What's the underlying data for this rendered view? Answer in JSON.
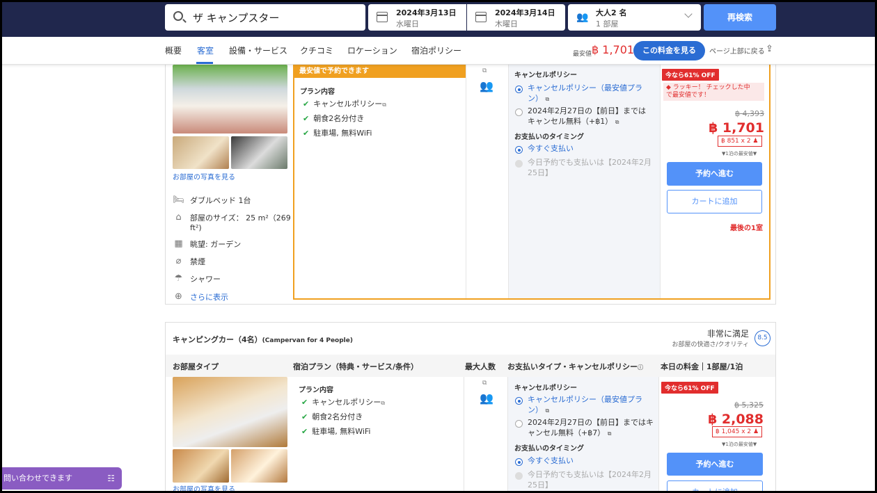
{
  "search": {
    "query": "ザ キャンプスター",
    "checkin_date": "2024年3月13日",
    "checkin_day": "水曜日",
    "checkout_date": "2024年3月14日",
    "checkout_day": "木曜日",
    "guests": "大人2 名",
    "rooms": "1 部屋",
    "button": "再検索"
  },
  "tabs": [
    "概要",
    "客室",
    "設備・サービス",
    "クチコミ",
    "ロケーション",
    "宿泊ポリシー"
  ],
  "tabbar": {
    "cheapest_label": "最安値",
    "cheapest_price": "฿ 1,701",
    "see_price": "この料金を見る",
    "back_to_top": "ページ上部に戻る"
  },
  "room1": {
    "see_photos": "お部屋の写真を見る",
    "amenities": [
      {
        "icon": "bed-icon",
        "text": "ダブルベッド 1台"
      },
      {
        "icon": "room-size-icon",
        "text": "部屋のサイズ： 25 m²（269"
      },
      {
        "icon": "room-size-icon",
        "text": "ft²)"
      },
      {
        "icon": "view-icon",
        "text": "眺望: ガーデン"
      },
      {
        "icon": "no-smoking-icon",
        "text": "禁煙"
      },
      {
        "icon": "shower-icon",
        "text": "シャワー"
      }
    ],
    "show_more": "さらに表示",
    "best_label": "最安値で予約できます",
    "plan_title": "プラン内容",
    "plan_items": [
      "キャンセルポリシー",
      "朝食2名分付き",
      "駐車場, 無料WiFi"
    ],
    "cancel_title": "キャンセルポリシー",
    "cancel_opt1": "キャンセルポリシー（最安値プラ",
    "cancel_opt1b": "ン）",
    "cancel_opt2": "2024年2月27日の【前日】までは",
    "cancel_opt2b": "キャンセル無料（+฿1）",
    "pay_title": "お支払いのタイミング",
    "pay_opt1": "今すぐ支払い",
    "pay_opt2": "今日予約でも支払いは【2024年2月",
    "pay_opt2b": "25日】",
    "off": "今なら61% OFF",
    "lucky": "ラッキー！ チェックした中",
    "lucky2": "で最安値です！",
    "orig": "฿ 4,393",
    "price": "฿ 1,701",
    "pernight": "฿ 851 x 2",
    "lowest": "▼1泊の最安値▼",
    "book": "予約へ進む",
    "cart": "カートに追加",
    "last": "最後の1室"
  },
  "room2": {
    "name": "キャンピングカー（4名）",
    "name_en": "(Campervan for 4 People)",
    "rating_label": "非常に満足",
    "rating_sub": "お部屋の快適さ/クオリティ",
    "score": "8.5",
    "headers": [
      "お部屋タイプ",
      "宿泊プラン（特典・サービス/条件）",
      "最大人数",
      "お支払いタイプ・キャンセルポリシー",
      "本日の料金｜1部屋/1泊"
    ],
    "see_photos": "お部屋の写真を見る",
    "plan_title": "プラン内容",
    "plan_items": [
      "キャンセルポリシー",
      "朝食2名分付き",
      "駐車場, 無料WiFi"
    ],
    "cancel_title": "キャンセルポリシー",
    "cancel_opt1": "キャンセルポリシー（最安値プラ",
    "cancel_opt1b": "ン）",
    "cancel_opt2": "2024年2月27日の【前日】まではキ",
    "cancel_opt2b": "ャンセル無料（+฿7）",
    "pay_title": "お支払いのタイミング",
    "pay_opt1": "今すぐ支払い",
    "pay_opt2": "今日予約でも支払いは【2024年2月",
    "pay_opt2b": "25日】",
    "off": "今なら61% OFF",
    "orig": "฿ 5,325",
    "price": "฿ 2,088",
    "pernight": "฿ 1,045 x 2",
    "lowest": "▼1泊の最安値▼",
    "book": "予約へ進む",
    "cart": "カートに追加"
  },
  "chat": "問い合わせできます",
  "colors": {
    "topbar": "#20274d",
    "accent": "#5392f9",
    "link": "#2a6cd3",
    "price": "#e12d2d",
    "orange": "#f0a020",
    "chat": "#8a5cc2"
  }
}
